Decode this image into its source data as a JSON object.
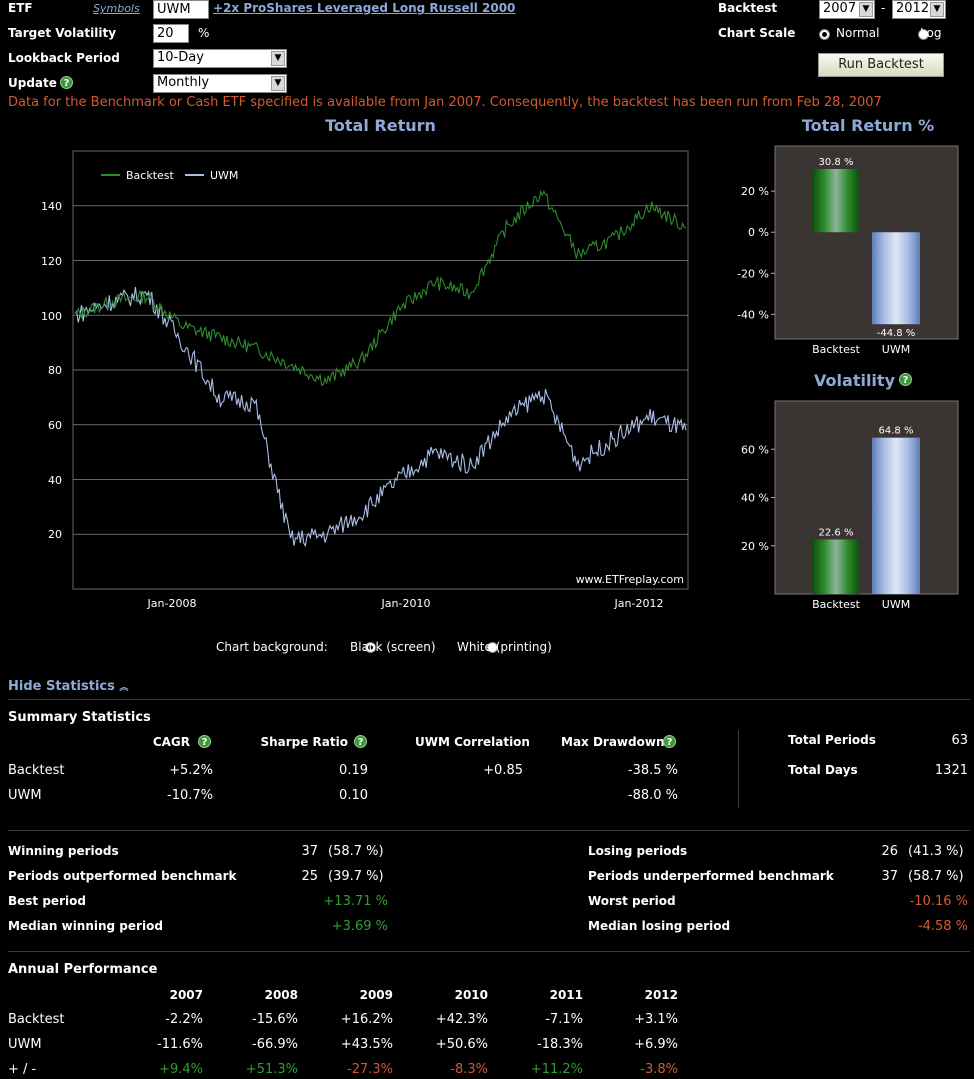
{
  "form": {
    "etf_label": "ETF",
    "symbols_link": "Symbols",
    "etf_value": "UWM",
    "etf_name_link": "+2x ProShares Leveraged Long Russell 2000",
    "target_vol_label": "Target Volatility",
    "target_vol_value": "20",
    "target_vol_unit": "%",
    "lookback_label": "Lookback Period",
    "lookback_value": "10-Day",
    "update_label": "Update",
    "update_value": "Monthly",
    "backtest_label": "Backtest",
    "backtest_from": "2007",
    "backtest_dash": "-",
    "backtest_to": "2012",
    "chart_scale_label": "Chart Scale",
    "scale_normal": "Normal",
    "scale_log": "Log",
    "run_button": "Run Backtest",
    "notice": "Data for the Benchmark or Cash ETF specified is available from Jan 2007. Consequently, the backtest has been run from Feb 28, 2007"
  },
  "colors": {
    "backtest": "#2e8b2e",
    "benchmark": "#a8bde6",
    "positive": "#2fa02f",
    "negative": "#d35a30",
    "accent": "#8fa9d6"
  },
  "main_chart": {
    "title": "Total Return",
    "legend": [
      "Backtest",
      "UWM"
    ],
    "y_ticks": [
      "140",
      "120",
      "100",
      "80",
      "60",
      "40",
      "20"
    ],
    "x_ticks": [
      "Jan-2008",
      "Jan-2010",
      "Jan-2012"
    ],
    "watermark": "www.ETFreplay.com"
  },
  "chart_data": [
    {
      "type": "line",
      "title": "Total Return",
      "x": [
        "Feb-2007",
        "Jun-2007",
        "Oct-2007",
        "Feb-2008",
        "Jun-2008",
        "Oct-2008",
        "Feb-2009",
        "Jun-2009",
        "Oct-2009",
        "Feb-2010",
        "Jun-2010",
        "Oct-2010",
        "Feb-2011",
        "Jun-2011",
        "Oct-2011",
        "Feb-2012",
        "Jun-2012",
        "Aug-2012"
      ],
      "series": [
        {
          "name": "Backtest",
          "values": [
            100,
            105,
            107,
            96,
            92,
            88,
            82,
            76,
            84,
            102,
            112,
            108,
            132,
            145,
            122,
            128,
            140,
            132
          ]
        },
        {
          "name": "UWM",
          "values": [
            100,
            105,
            108,
            90,
            70,
            68,
            18,
            20,
            28,
            40,
            50,
            45,
            62,
            72,
            46,
            55,
            63,
            58
          ]
        }
      ],
      "ylim": [
        0,
        160
      ],
      "grid": true,
      "legend_position": "top-left"
    },
    {
      "type": "bar",
      "title": "Total Return %",
      "categories": [
        "Backtest",
        "UWM"
      ],
      "values": [
        30.8,
        -44.8
      ],
      "value_labels": [
        "30.8 %",
        "-44.8 %"
      ],
      "y_ticks": [
        "20 %",
        "0 %",
        "-20 %",
        "-40 %"
      ],
      "ylim": [
        -52,
        42
      ]
    },
    {
      "type": "bar",
      "title": "Volatility",
      "categories": [
        "Backtest",
        "UWM"
      ],
      "values": [
        22.6,
        64.8
      ],
      "value_labels": [
        "22.6 %",
        "64.8 %"
      ],
      "y_ticks": [
        "60 %",
        "40 %",
        "20 %"
      ],
      "ylim": [
        0,
        80
      ]
    }
  ],
  "chart_bg": {
    "label": "Chart background:",
    "black": "Black (screen)",
    "white": "White (printing)"
  },
  "hide_stats": "Hide Statistics",
  "summary": {
    "title": "Summary Statistics",
    "headers": [
      "CAGR",
      "Sharpe Ratio",
      "UWM Correlation",
      "Max Drawdown"
    ],
    "rows": [
      {
        "name": "Backtest",
        "cagr": "+5.2%",
        "sharpe": "0.19",
        "corr": "+0.85",
        "maxdd": "-38.5 %"
      },
      {
        "name": "UWM",
        "cagr": "-10.7%",
        "sharpe": "0.10",
        "corr": "",
        "maxdd": "-88.0 %"
      }
    ],
    "total_periods_label": "Total Periods",
    "total_periods": "63",
    "total_days_label": "Total Days",
    "total_days": "1321"
  },
  "periods": {
    "winning_label": "Winning periods",
    "winning_n": "37",
    "winning_pct": "(58.7 %)",
    "outperf_label": "Periods outperformed benchmark",
    "outperf_n": "25",
    "outperf_pct": "(39.7 %)",
    "best_label": "Best period",
    "best": "+13.71 %",
    "median_win_label": "Median winning period",
    "median_win": "+3.69 %",
    "losing_label": "Losing periods",
    "losing_n": "26",
    "losing_pct": "(41.3 %)",
    "underperf_label": "Periods underperformed benchmark",
    "underperf_n": "37",
    "underperf_pct": "(58.7 %)",
    "worst_label": "Worst period",
    "worst": "-10.16 %",
    "median_lose_label": "Median losing period",
    "median_lose": "-4.58 %"
  },
  "annual": {
    "title": "Annual Performance",
    "years": [
      "2007",
      "2008",
      "2009",
      "2010",
      "2011",
      "2012"
    ],
    "rows": [
      {
        "name": "Backtest",
        "values": [
          "-2.2%",
          "-15.6%",
          "+16.2%",
          "+42.3%",
          "-7.1%",
          "+3.1%"
        ]
      },
      {
        "name": "UWM",
        "values": [
          "-11.6%",
          "-66.9%",
          "+43.5%",
          "+50.6%",
          "-18.3%",
          "+6.9%"
        ]
      },
      {
        "name": "+ / -",
        "values": [
          "+9.4%",
          "+51.3%",
          "-27.3%",
          "-8.3%",
          "+11.2%",
          "-3.8%"
        ]
      }
    ]
  }
}
